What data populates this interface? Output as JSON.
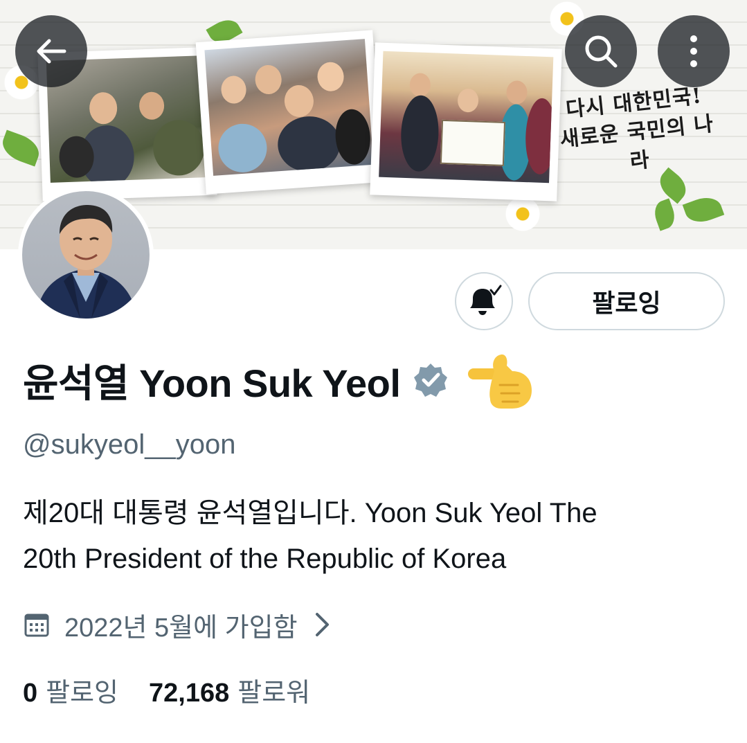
{
  "banner": {
    "slogan_line1": "다시 대한민국!",
    "slogan_line2": "새로운 국민의 나라"
  },
  "nav": {
    "back_icon": "arrow-left-icon",
    "search_icon": "search-icon",
    "more_icon": "more-vertical-icon"
  },
  "actions": {
    "notification_icon": "bell-check-icon",
    "follow_label": "팔로잉"
  },
  "profile": {
    "display_name": "윤석열 Yoon Suk Yeol",
    "verified_icon": "verified-badge-icon",
    "emoji": "pointing-hand-emoji",
    "handle": "@sukyeol__yoon",
    "bio_line1": "제20대 대통령 윤석열입니다. Yoon Suk Yeol The",
    "bio_line2": "20th President of the Republic of Korea",
    "joined": "2022년 5월에 가입함",
    "joined_icon": "calendar-icon"
  },
  "stats": {
    "following_count": "0",
    "following_label": "팔로잉",
    "followers_count": "72,168",
    "followers_label": "팔로워"
  },
  "colors": {
    "text_primary": "#0f1419",
    "text_secondary": "#536471",
    "border": "#cfd9de",
    "verified": "#829aab"
  }
}
